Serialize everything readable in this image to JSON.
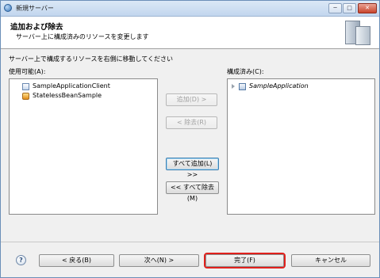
{
  "window": {
    "title": "新規サーバー",
    "controls": {
      "minimize": "─",
      "maximize": "□",
      "close": "✕"
    }
  },
  "header": {
    "title": "追加および除去",
    "description": "サーバー上に構成済みのリソースを変更します",
    "icon": "server-icon"
  },
  "instruction": "サーバー上で構成するリソースを右側に移動してください",
  "available": {
    "label": "使用可能(A):",
    "items": [
      {
        "label": "SampleApplicationClient",
        "icon": "client-project-icon"
      },
      {
        "label": "StatelessBeanSample",
        "icon": "ejb-project-icon"
      }
    ]
  },
  "configured": {
    "label": "構成済み(C):",
    "items": [
      {
        "label": "SampleApplication",
        "icon": "application-icon"
      }
    ]
  },
  "transfer_buttons": {
    "add": "追加(D) >",
    "remove": "< 除去(R)",
    "add_all": "すべて追加(L) >>",
    "remove_all": "<< すべて除去(M)"
  },
  "footer": {
    "help": "?",
    "back": "< 戻る(B)",
    "next": "次へ(N) >",
    "finish": "完了(F)",
    "cancel": "キャンセル"
  }
}
